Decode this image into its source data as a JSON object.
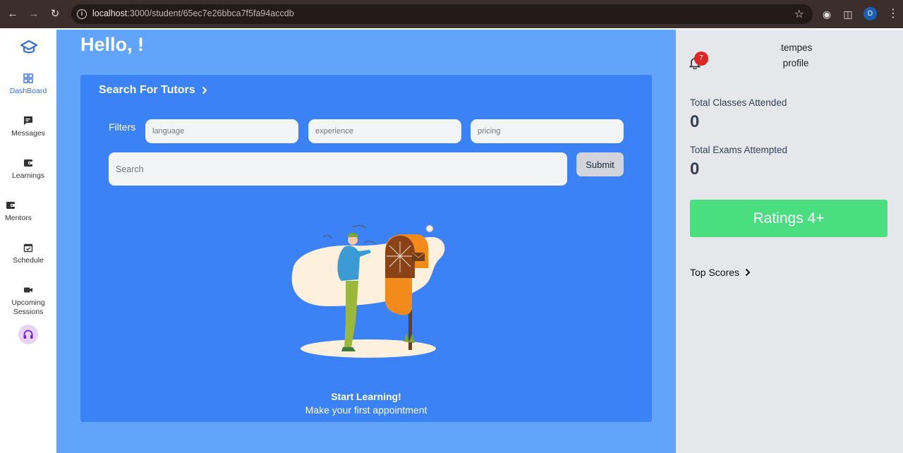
{
  "browser": {
    "url_host": "localhost",
    "url_rest": ":3000/student/65ec7e26bbca7f5fa94accdb",
    "profile_initial": "D"
  },
  "sidebar": {
    "items": [
      {
        "label": "DashBoard",
        "icon": "dashboard-icon"
      },
      {
        "label": "Messages",
        "icon": "messages-icon"
      },
      {
        "label": "Learnings",
        "icon": "wallet-icon"
      },
      {
        "label": "Mentors",
        "icon": "wallet-icon"
      },
      {
        "label": "Schedule",
        "icon": "calendar-check-icon"
      },
      {
        "label": "Upcoming Sessions",
        "icon": "video-camera-icon"
      }
    ],
    "support_icon": "headphones-icon",
    "active_color": "#3b6fd9"
  },
  "main": {
    "greeting": "Hello, !",
    "card_title": "Search For Tutors",
    "filters_label": "Filters",
    "filters": [
      {
        "placeholder": "language"
      },
      {
        "placeholder": "experience"
      },
      {
        "placeholder": "pricing"
      }
    ],
    "search_placeholder": "Search",
    "submit_label": "Submit",
    "empty_title": "Start Learning!",
    "empty_subtitle": "Make your first appointment"
  },
  "right": {
    "notification_count": "7",
    "profile_alt_line1": "tempes",
    "profile_alt_line2": "profile",
    "stats": [
      {
        "label": "Total Classes Attended",
        "value": "0"
      },
      {
        "label": "Total Exams Attempted",
        "value": "0"
      }
    ],
    "ratings_label": "Ratings 4+",
    "top_scores_label": "Top Scores"
  },
  "colors": {
    "main_bg": "#60a5fa",
    "card_bg": "#3b82f6",
    "right_bg": "#e5e7eb",
    "ratings_bg": "#4ade80",
    "badge": "#dc2626"
  }
}
